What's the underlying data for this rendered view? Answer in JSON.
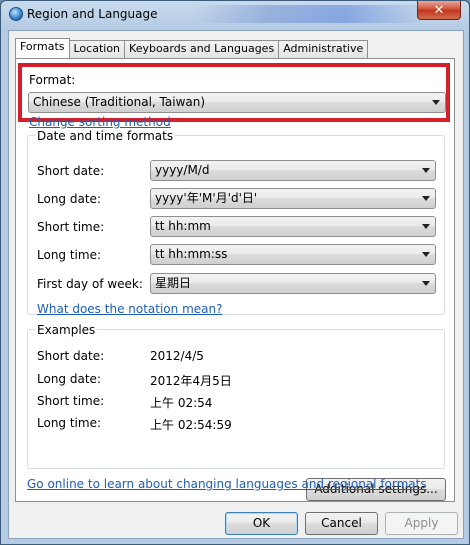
{
  "window": {
    "title": "Region and Language",
    "close_glyph": "✕"
  },
  "tabs": [
    {
      "label": "Formats",
      "active": true
    },
    {
      "label": "Location",
      "active": false
    },
    {
      "label": "Keyboards and Languages",
      "active": false
    },
    {
      "label": "Administrative",
      "active": false
    }
  ],
  "format": {
    "label": "Format:",
    "value": "Chinese (Traditional, Taiwan)",
    "highlight_color": "#d4202a"
  },
  "change_sorting_link": "Change sorting method",
  "date_time": {
    "title": "Date and time formats",
    "short_date": {
      "label": "Short date:",
      "value": "yyyy/M/d"
    },
    "long_date": {
      "label": "Long date:",
      "value": "yyyy'年'M'月'd'日'"
    },
    "short_time": {
      "label": "Short time:",
      "value": "tt hh:mm"
    },
    "long_time": {
      "label": "Long time:",
      "value": "tt hh:mm:ss"
    },
    "first_day": {
      "label": "First day of week:",
      "value": "星期日"
    },
    "notation_link": "What does the notation mean?"
  },
  "examples": {
    "title": "Examples",
    "short_date": {
      "label": "Short date:",
      "value": "2012/4/5"
    },
    "long_date": {
      "label": "Long date:",
      "value": "2012年4月5日"
    },
    "short_time": {
      "label": "Short time:",
      "value": "上午 02:54"
    },
    "long_time": {
      "label": "Long time:",
      "value": "上午 02:54:59"
    }
  },
  "additional_settings_button": "Additional settings...",
  "online_link": "Go online to learn about changing languages and regional formats",
  "footer": {
    "ok": "OK",
    "cancel": "Cancel",
    "apply": "Apply"
  },
  "colors": {
    "link": "#1e5fb4",
    "accent_close": "#c3351c"
  }
}
